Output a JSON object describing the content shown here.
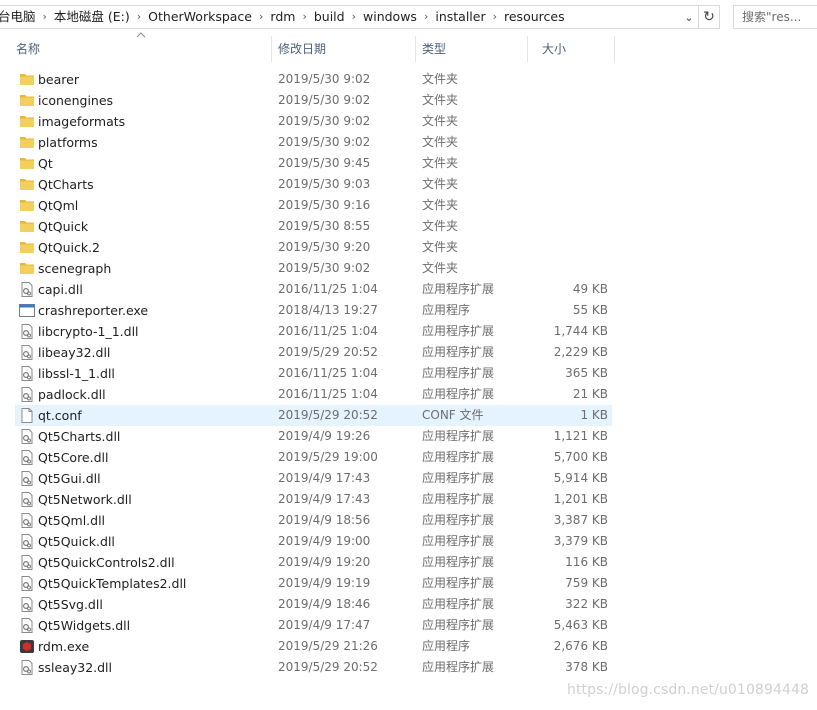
{
  "address": {
    "crumbs": [
      "台电脑",
      "本地磁盘 (E:)",
      "OtherWorkspace",
      "rdm",
      "build",
      "windows",
      "installer",
      "resources"
    ],
    "refresh_glyph": "↻",
    "dropdown_glyph": "⌄"
  },
  "search": {
    "text": "搜索\"res..."
  },
  "columns": {
    "name": "名称",
    "date": "修改日期",
    "type": "类型",
    "size": "大小"
  },
  "colors": {
    "folder": "#e8b73a",
    "selected_row": "#e5f3ff",
    "header_text": "#4c607a"
  },
  "files": [
    {
      "icon": "folder-icon",
      "name": "bearer",
      "date": "2019/5/30 9:02",
      "type": "文件夹",
      "size": ""
    },
    {
      "icon": "folder-icon",
      "name": "iconengines",
      "date": "2019/5/30 9:02",
      "type": "文件夹",
      "size": ""
    },
    {
      "icon": "folder-icon",
      "name": "imageformats",
      "date": "2019/5/30 9:02",
      "type": "文件夹",
      "size": ""
    },
    {
      "icon": "folder-icon",
      "name": "platforms",
      "date": "2019/5/30 9:02",
      "type": "文件夹",
      "size": ""
    },
    {
      "icon": "folder-icon",
      "name": "Qt",
      "date": "2019/5/30 9:45",
      "type": "文件夹",
      "size": ""
    },
    {
      "icon": "folder-icon",
      "name": "QtCharts",
      "date": "2019/5/30 9:03",
      "type": "文件夹",
      "size": ""
    },
    {
      "icon": "folder-icon",
      "name": "QtQml",
      "date": "2019/5/30 9:16",
      "type": "文件夹",
      "size": ""
    },
    {
      "icon": "folder-icon",
      "name": "QtQuick",
      "date": "2019/5/30 8:55",
      "type": "文件夹",
      "size": ""
    },
    {
      "icon": "folder-icon",
      "name": "QtQuick.2",
      "date": "2019/5/30 9:20",
      "type": "文件夹",
      "size": ""
    },
    {
      "icon": "folder-icon",
      "name": "scenegraph",
      "date": "2019/5/30 9:02",
      "type": "文件夹",
      "size": ""
    },
    {
      "icon": "dll-icon",
      "name": "capi.dll",
      "date": "2016/11/25 1:04",
      "type": "应用程序扩展",
      "size": "49 KB"
    },
    {
      "icon": "exe-icon",
      "name": "crashreporter.exe",
      "date": "2018/4/13 19:27",
      "type": "应用程序",
      "size": "55 KB"
    },
    {
      "icon": "dll-icon",
      "name": "libcrypto-1_1.dll",
      "date": "2016/11/25 1:04",
      "type": "应用程序扩展",
      "size": "1,744 KB"
    },
    {
      "icon": "dll-icon",
      "name": "libeay32.dll",
      "date": "2019/5/29 20:52",
      "type": "应用程序扩展",
      "size": "2,229 KB"
    },
    {
      "icon": "dll-icon",
      "name": "libssl-1_1.dll",
      "date": "2016/11/25 1:04",
      "type": "应用程序扩展",
      "size": "365 KB"
    },
    {
      "icon": "dll-icon",
      "name": "padlock.dll",
      "date": "2016/11/25 1:04",
      "type": "应用程序扩展",
      "size": "21 KB"
    },
    {
      "icon": "file-icon",
      "name": "qt.conf",
      "date": "2019/5/29 20:52",
      "type": "CONF 文件",
      "size": "1 KB",
      "selected": true
    },
    {
      "icon": "dll-icon",
      "name": "Qt5Charts.dll",
      "date": "2019/4/9 19:26",
      "type": "应用程序扩展",
      "size": "1,121 KB"
    },
    {
      "icon": "dll-icon",
      "name": "Qt5Core.dll",
      "date": "2019/5/29 19:00",
      "type": "应用程序扩展",
      "size": "5,700 KB"
    },
    {
      "icon": "dll-icon",
      "name": "Qt5Gui.dll",
      "date": "2019/4/9 17:43",
      "type": "应用程序扩展",
      "size": "5,914 KB"
    },
    {
      "icon": "dll-icon",
      "name": "Qt5Network.dll",
      "date": "2019/4/9 17:43",
      "type": "应用程序扩展",
      "size": "1,201 KB"
    },
    {
      "icon": "dll-icon",
      "name": "Qt5Qml.dll",
      "date": "2019/4/9 18:56",
      "type": "应用程序扩展",
      "size": "3,387 KB"
    },
    {
      "icon": "dll-icon",
      "name": "Qt5Quick.dll",
      "date": "2019/4/9 19:00",
      "type": "应用程序扩展",
      "size": "3,379 KB"
    },
    {
      "icon": "dll-icon",
      "name": "Qt5QuickControls2.dll",
      "date": "2019/4/9 19:20",
      "type": "应用程序扩展",
      "size": "116 KB"
    },
    {
      "icon": "dll-icon",
      "name": "Qt5QuickTemplates2.dll",
      "date": "2019/4/9 19:19",
      "type": "应用程序扩展",
      "size": "759 KB"
    },
    {
      "icon": "dll-icon",
      "name": "Qt5Svg.dll",
      "date": "2019/4/9 18:46",
      "type": "应用程序扩展",
      "size": "322 KB"
    },
    {
      "icon": "dll-icon",
      "name": "Qt5Widgets.dll",
      "date": "2019/4/9 17:47",
      "type": "应用程序扩展",
      "size": "5,463 KB"
    },
    {
      "icon": "app-icon",
      "name": "rdm.exe",
      "date": "2019/5/29 21:26",
      "type": "应用程序",
      "size": "2,676 KB"
    },
    {
      "icon": "dll-icon",
      "name": "ssleay32.dll",
      "date": "2019/5/29 20:52",
      "type": "应用程序扩展",
      "size": "378 KB"
    }
  ],
  "watermark": "https://blog.csdn.net/u010894448"
}
